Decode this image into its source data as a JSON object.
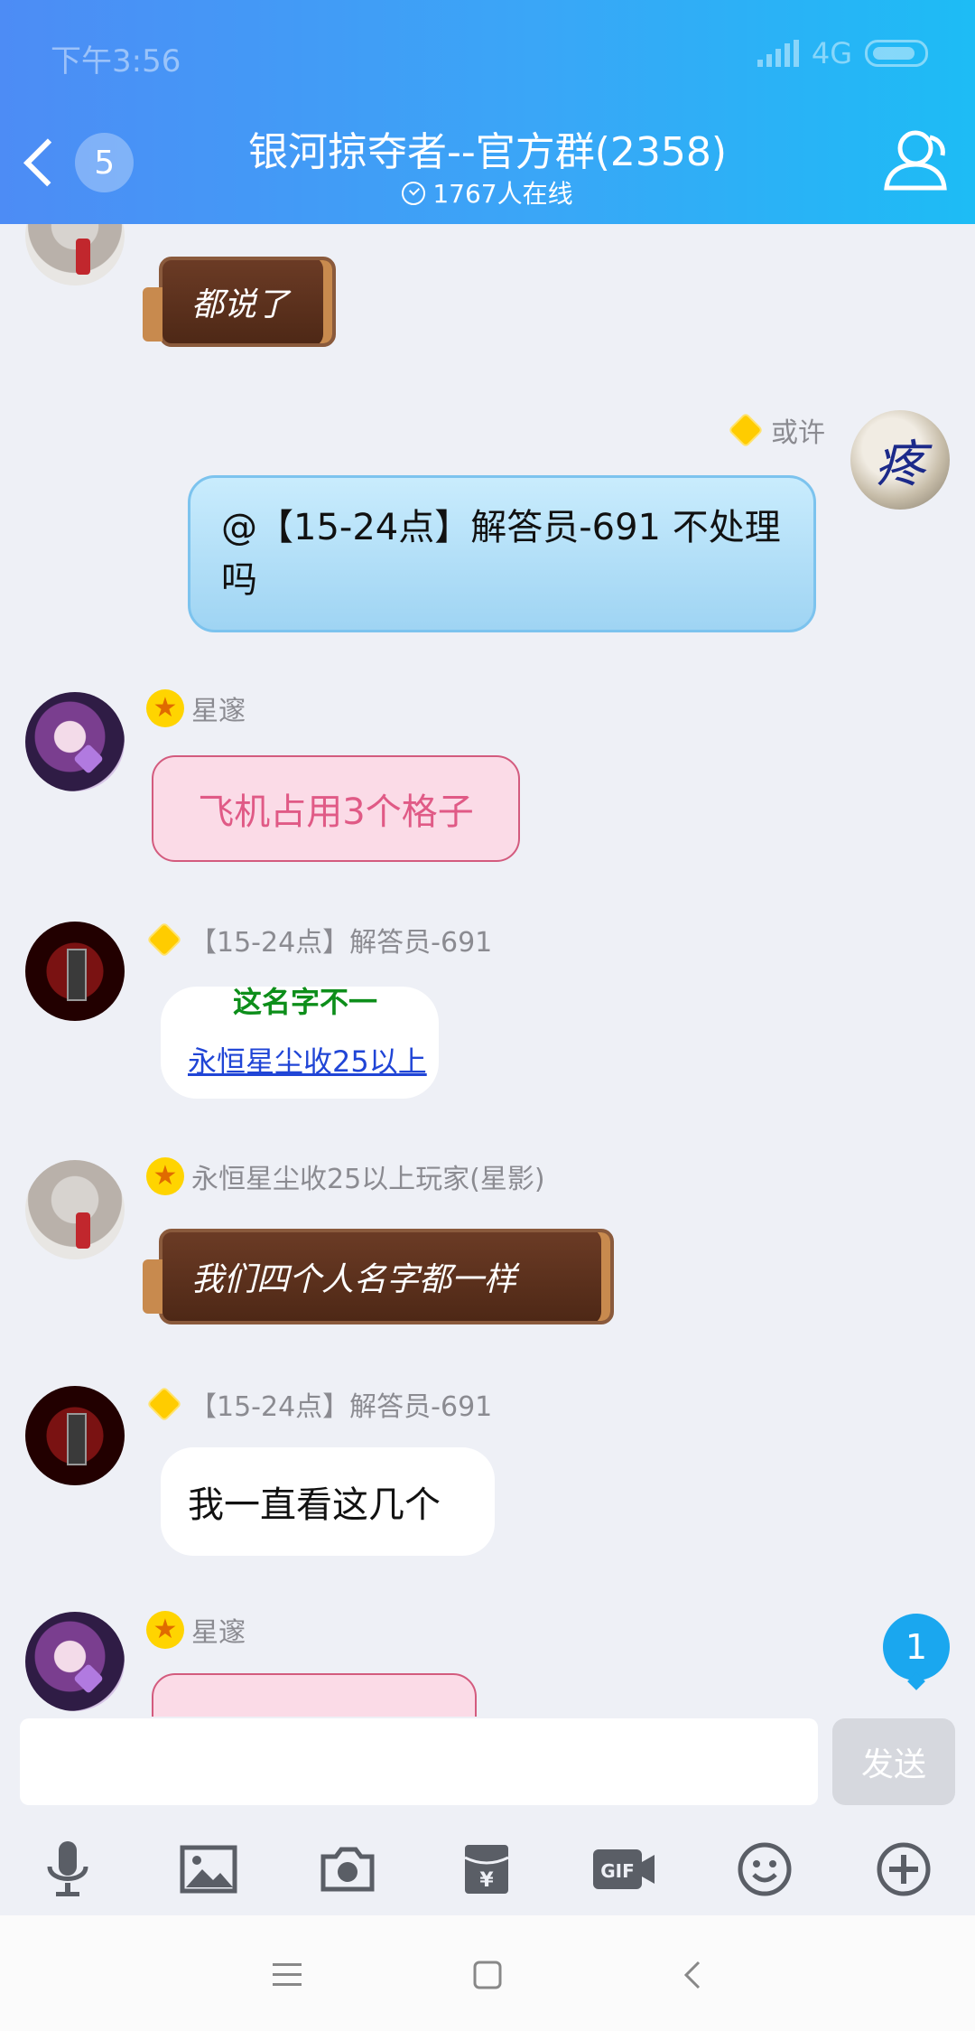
{
  "status_bar": {
    "time": "下午3:56",
    "network": "4G"
  },
  "header": {
    "back_count": "5",
    "title": "银河掠夺者--官方群(2358)",
    "online_text": "1767人在线"
  },
  "messages": [
    {
      "sender": "",
      "text": "都说了",
      "style": "chocolate",
      "avatar": "cat-avatar"
    },
    {
      "sender": "或许",
      "text": "@【15-24点】解答员-691 不处理吗",
      "style": "blue-self",
      "avatar": "moon-avatar"
    },
    {
      "sender": "星邃",
      "text": "飞机占用3个格子",
      "style": "pink",
      "avatar": "anime-avatar"
    },
    {
      "sender": "【15-24点】解答员-691",
      "style": "image",
      "image_text_top": "这名字不一",
      "image_text_link": "永恒星尘收25以上",
      "avatar": "spaceship-avatar"
    },
    {
      "sender": "永恒星尘收25以上玩家(星影)",
      "text": "我们四个人名字都一样",
      "style": "chocolate",
      "avatar": "cat-avatar"
    },
    {
      "sender": "【15-24点】解答员-691",
      "text": "我一直看这几个",
      "style": "white",
      "avatar": "spaceship-avatar"
    },
    {
      "sender": "星邃",
      "text": "",
      "style": "pink",
      "avatar": "anime-avatar"
    }
  ],
  "unread_count": "1",
  "input": {
    "placeholder": "",
    "send_label": "发送"
  },
  "toolbar_icons": [
    "microphone-icon",
    "image-icon",
    "camera-icon",
    "red-packet-icon",
    "gif-icon",
    "emoji-icon",
    "plus-icon"
  ],
  "nav_icons": [
    "menu-icon",
    "home-icon",
    "back-icon"
  ]
}
